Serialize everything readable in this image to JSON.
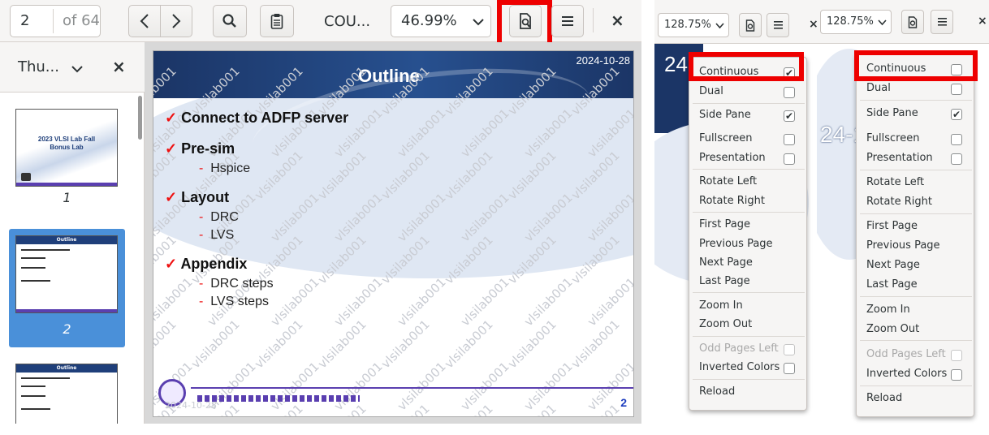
{
  "viewer": {
    "page_number": "2",
    "page_total": "of 64",
    "doc_title": "COU...",
    "zoom": "46.99%",
    "close": "×",
    "menu_icon": "hamburger-icon",
    "sidebar_mode": "Thu...",
    "sidebar_close": "×",
    "thumbs": [
      {
        "num": "1",
        "title": "2023 VLSI Lab Fall",
        "subtitle": "Bonus Lab"
      },
      {
        "num": "2",
        "title": "Outline"
      },
      {
        "num": "",
        "title": "Outline"
      }
    ]
  },
  "slide": {
    "date": "2024-10-28",
    "title": "Outline",
    "watermark": "vlsilab001",
    "items": [
      {
        "text": "Connect to ADFP server",
        "subs": []
      },
      {
        "text": "Pre-sim",
        "subs": [
          "Hspice"
        ]
      },
      {
        "text": "Layout",
        "subs": [
          "DRC",
          "LVS"
        ]
      },
      {
        "text": "Appendix",
        "subs": [
          "DRC steps",
          "LVS steps"
        ]
      }
    ],
    "page_number": "2",
    "check_glyph": "✓",
    "dash_glyph": "-",
    "footer_date_stub": "2024-10-28"
  },
  "menus": [
    {
      "zoom": "128.75%",
      "items": [
        {
          "label": "Continuous",
          "checked": true
        },
        {
          "label": "Dual",
          "checked": false
        },
        {
          "label": "Side Pane",
          "checked": true
        },
        {
          "label": "Fullscreen",
          "checked": false
        },
        {
          "label": "Presentation",
          "checked": false
        },
        {
          "label": "Rotate Left"
        },
        {
          "label": "Rotate Right"
        },
        {
          "label": "First Page"
        },
        {
          "label": "Previous Page"
        },
        {
          "label": "Next Page"
        },
        {
          "label": "Last Page"
        },
        {
          "label": "Zoom In"
        },
        {
          "label": "Zoom Out"
        },
        {
          "label": "Odd Pages Left",
          "checked": false,
          "disabled": true
        },
        {
          "label": "Inverted Colors",
          "checked": false
        },
        {
          "label": "Reload"
        }
      ]
    },
    {
      "zoom": "128.75%",
      "items": [
        {
          "label": "Continuous",
          "checked": false
        },
        {
          "label": "Dual",
          "checked": false
        },
        {
          "label": "Side Pane",
          "checked": true
        },
        {
          "label": "Fullscreen",
          "checked": false
        },
        {
          "label": "Presentation",
          "checked": false
        },
        {
          "label": "Rotate Left"
        },
        {
          "label": "Rotate Right"
        },
        {
          "label": "First Page"
        },
        {
          "label": "Previous Page"
        },
        {
          "label": "Next Page"
        },
        {
          "label": "Last Page"
        },
        {
          "label": "Zoom In"
        },
        {
          "label": "Zoom Out"
        },
        {
          "label": "Odd Pages Left",
          "checked": false,
          "disabled": true
        },
        {
          "label": "Inverted Colors",
          "checked": false
        },
        {
          "label": "Reload"
        }
      ]
    }
  ],
  "background_fragments": {
    "date_fragment_1": "24-1",
    "date_fragment_2": "24-1"
  },
  "colors": {
    "highlight": "#ee0000",
    "slide_header": "#1f3f7a",
    "selected_thumb": "#4a90d9"
  }
}
